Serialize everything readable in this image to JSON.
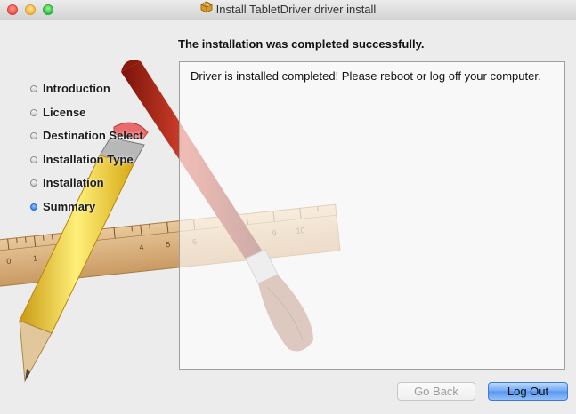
{
  "window": {
    "title": "Install TabletDriver driver install",
    "title_icon": "package-icon"
  },
  "heading": "The installation was completed successfully.",
  "steps": [
    {
      "label": "Introduction",
      "active": false
    },
    {
      "label": "License",
      "active": false
    },
    {
      "label": "Destination Select",
      "active": false
    },
    {
      "label": "Installation Type",
      "active": false
    },
    {
      "label": "Installation",
      "active": false
    },
    {
      "label": "Summary",
      "active": true
    }
  ],
  "content": {
    "message": "Driver is installed completed! Please reboot  or log off  your computer."
  },
  "buttons": {
    "back_label": "Go Back",
    "back_enabled": false,
    "logout_label": "Log Out"
  },
  "ruler_numbers": [
    "0",
    "1",
    "4",
    "5",
    "6",
    "9",
    "10"
  ],
  "colors": {
    "accent": "#3b86f0",
    "window_bg": "#ececec"
  }
}
